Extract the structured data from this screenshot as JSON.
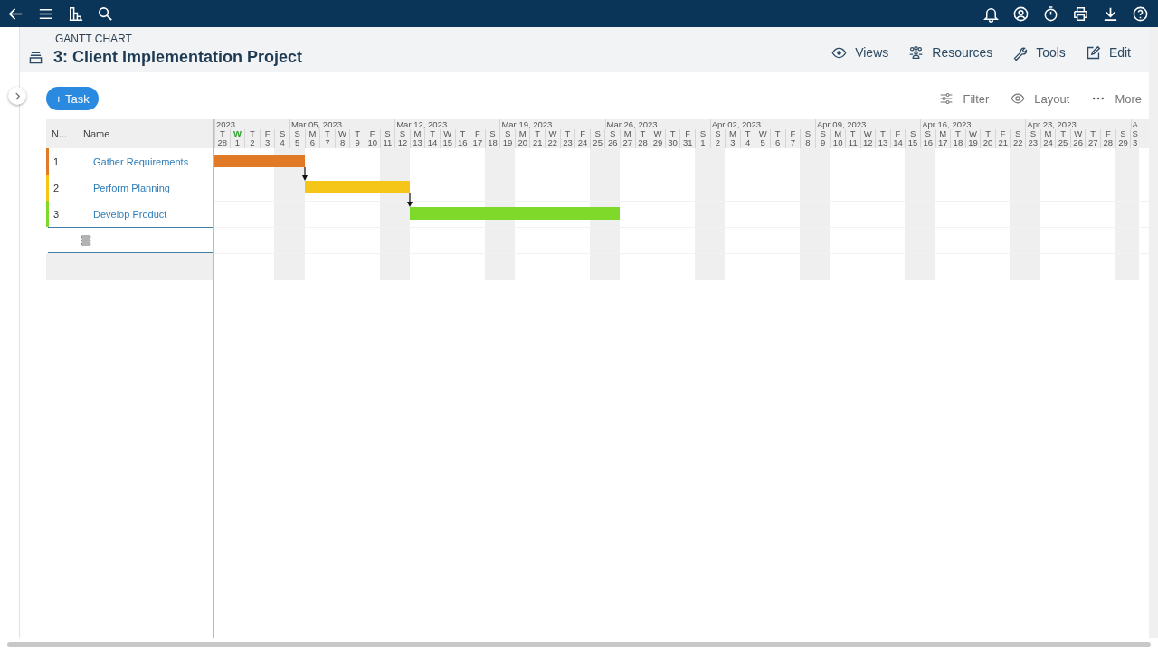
{
  "section_label": "GANTT CHART",
  "title": "3: Client Implementation Project",
  "header_actions": [
    {
      "kind": "views",
      "label": "Views"
    },
    {
      "kind": "resources",
      "label": "Resources"
    },
    {
      "kind": "tools",
      "label": "Tools"
    },
    {
      "kind": "edit",
      "label": "Edit"
    }
  ],
  "add_button": "+ Task",
  "toolbar": [
    {
      "kind": "filter",
      "label": "Filter"
    },
    {
      "kind": "layout",
      "label": "Layout"
    },
    {
      "kind": "more",
      "label": "More"
    }
  ],
  "grid": {
    "columns": [
      "N...",
      "Name"
    ],
    "tasks": [
      {
        "number": "1",
        "name": "Gather Requirements",
        "color": "#e07a26",
        "linked_to_previous": false
      },
      {
        "number": "2",
        "name": "Perform Planning",
        "color": "#f5c518",
        "linked_to_previous": true
      },
      {
        "number": "3",
        "name": "Develop Product",
        "color": "#7fd92b",
        "linked_to_previous": true
      }
    ]
  },
  "timeline": {
    "weeks": [
      {
        "label": "2023",
        "days": [
          {
            "letter": "T",
            "number": "28",
            "weekend": false,
            "today": false
          },
          {
            "letter": "W",
            "number": "1",
            "weekend": false,
            "today": true
          },
          {
            "letter": "T",
            "number": "2",
            "weekend": false,
            "today": false
          },
          {
            "letter": "F",
            "number": "3",
            "weekend": false,
            "today": false
          },
          {
            "letter": "S",
            "number": "4",
            "weekend": true,
            "today": false
          }
        ]
      },
      {
        "label": "Mar 05, 2023",
        "days": [
          {
            "letter": "S",
            "number": "5",
            "weekend": true,
            "today": false
          },
          {
            "letter": "M",
            "number": "6",
            "weekend": false,
            "today": false
          },
          {
            "letter": "T",
            "number": "7",
            "weekend": false,
            "today": false
          },
          {
            "letter": "W",
            "number": "8",
            "weekend": false,
            "today": false
          },
          {
            "letter": "T",
            "number": "9",
            "weekend": false,
            "today": false
          },
          {
            "letter": "F",
            "number": "10",
            "weekend": false,
            "today": false
          },
          {
            "letter": "S",
            "number": "11",
            "weekend": true,
            "today": false
          }
        ]
      },
      {
        "label": "Mar 12, 2023",
        "days": [
          {
            "letter": "S",
            "number": "12",
            "weekend": true,
            "today": false
          },
          {
            "letter": "M",
            "number": "13",
            "weekend": false,
            "today": false
          },
          {
            "letter": "T",
            "number": "14",
            "weekend": false,
            "today": false
          },
          {
            "letter": "W",
            "number": "15",
            "weekend": false,
            "today": false
          },
          {
            "letter": "T",
            "number": "16",
            "weekend": false,
            "today": false
          },
          {
            "letter": "F",
            "number": "17",
            "weekend": false,
            "today": false
          },
          {
            "letter": "S",
            "number": "18",
            "weekend": true,
            "today": false
          }
        ]
      },
      {
        "label": "Mar 19, 2023",
        "days": [
          {
            "letter": "S",
            "number": "19",
            "weekend": true,
            "today": false
          },
          {
            "letter": "M",
            "number": "20",
            "weekend": false,
            "today": false
          },
          {
            "letter": "T",
            "number": "21",
            "weekend": false,
            "today": false
          },
          {
            "letter": "W",
            "number": "22",
            "weekend": false,
            "today": false
          },
          {
            "letter": "T",
            "number": "23",
            "weekend": false,
            "today": false
          },
          {
            "letter": "F",
            "number": "24",
            "weekend": false,
            "today": false
          },
          {
            "letter": "S",
            "number": "25",
            "weekend": true,
            "today": false
          }
        ]
      },
      {
        "label": "Mar 26, 2023",
        "days": [
          {
            "letter": "S",
            "number": "26",
            "weekend": true,
            "today": false
          },
          {
            "letter": "M",
            "number": "27",
            "weekend": false,
            "today": false
          },
          {
            "letter": "T",
            "number": "28",
            "weekend": false,
            "today": false
          },
          {
            "letter": "W",
            "number": "29",
            "weekend": false,
            "today": false
          },
          {
            "letter": "T",
            "number": "30",
            "weekend": false,
            "today": false
          },
          {
            "letter": "F",
            "number": "31",
            "weekend": false,
            "today": false
          },
          {
            "letter": "S",
            "number": "1",
            "weekend": true,
            "today": false
          }
        ]
      },
      {
        "label": "Apr 02, 2023",
        "days": [
          {
            "letter": "S",
            "number": "2",
            "weekend": true,
            "today": false
          },
          {
            "letter": "M",
            "number": "3",
            "weekend": false,
            "today": false
          },
          {
            "letter": "T",
            "number": "4",
            "weekend": false,
            "today": false
          },
          {
            "letter": "W",
            "number": "5",
            "weekend": false,
            "today": false
          },
          {
            "letter": "T",
            "number": "6",
            "weekend": false,
            "today": false
          },
          {
            "letter": "F",
            "number": "7",
            "weekend": false,
            "today": false
          },
          {
            "letter": "S",
            "number": "8",
            "weekend": true,
            "today": false
          }
        ]
      },
      {
        "label": "Apr 09, 2023",
        "days": [
          {
            "letter": "S",
            "number": "9",
            "weekend": true,
            "today": false
          },
          {
            "letter": "M",
            "number": "10",
            "weekend": false,
            "today": false
          },
          {
            "letter": "T",
            "number": "11",
            "weekend": false,
            "today": false
          },
          {
            "letter": "W",
            "number": "12",
            "weekend": false,
            "today": false
          },
          {
            "letter": "T",
            "number": "13",
            "weekend": false,
            "today": false
          },
          {
            "letter": "F",
            "number": "14",
            "weekend": false,
            "today": false
          },
          {
            "letter": "S",
            "number": "15",
            "weekend": true,
            "today": false
          }
        ]
      },
      {
        "label": "Apr 16, 2023",
        "days": [
          {
            "letter": "S",
            "number": "16",
            "weekend": true,
            "today": false
          },
          {
            "letter": "M",
            "number": "17",
            "weekend": false,
            "today": false
          },
          {
            "letter": "T",
            "number": "18",
            "weekend": false,
            "today": false
          },
          {
            "letter": "W",
            "number": "19",
            "weekend": false,
            "today": false
          },
          {
            "letter": "T",
            "number": "20",
            "weekend": false,
            "today": false
          },
          {
            "letter": "F",
            "number": "21",
            "weekend": false,
            "today": false
          },
          {
            "letter": "S",
            "number": "22",
            "weekend": true,
            "today": false
          }
        ]
      },
      {
        "label": "Apr 23, 2023",
        "days": [
          {
            "letter": "S",
            "number": "23",
            "weekend": true,
            "today": false
          },
          {
            "letter": "M",
            "number": "24",
            "weekend": false,
            "today": false
          },
          {
            "letter": "T",
            "number": "25",
            "weekend": false,
            "today": false
          },
          {
            "letter": "W",
            "number": "26",
            "weekend": false,
            "today": false
          },
          {
            "letter": "T",
            "number": "27",
            "weekend": false,
            "today": false
          },
          {
            "letter": "F",
            "number": "28",
            "weekend": false,
            "today": false
          },
          {
            "letter": "S",
            "number": "29",
            "weekend": true,
            "today": false
          }
        ]
      },
      {
        "label": "A",
        "days": [
          {
            "letter": "S",
            "number": "3",
            "weekend": true,
            "today": false
          }
        ]
      }
    ]
  }
}
